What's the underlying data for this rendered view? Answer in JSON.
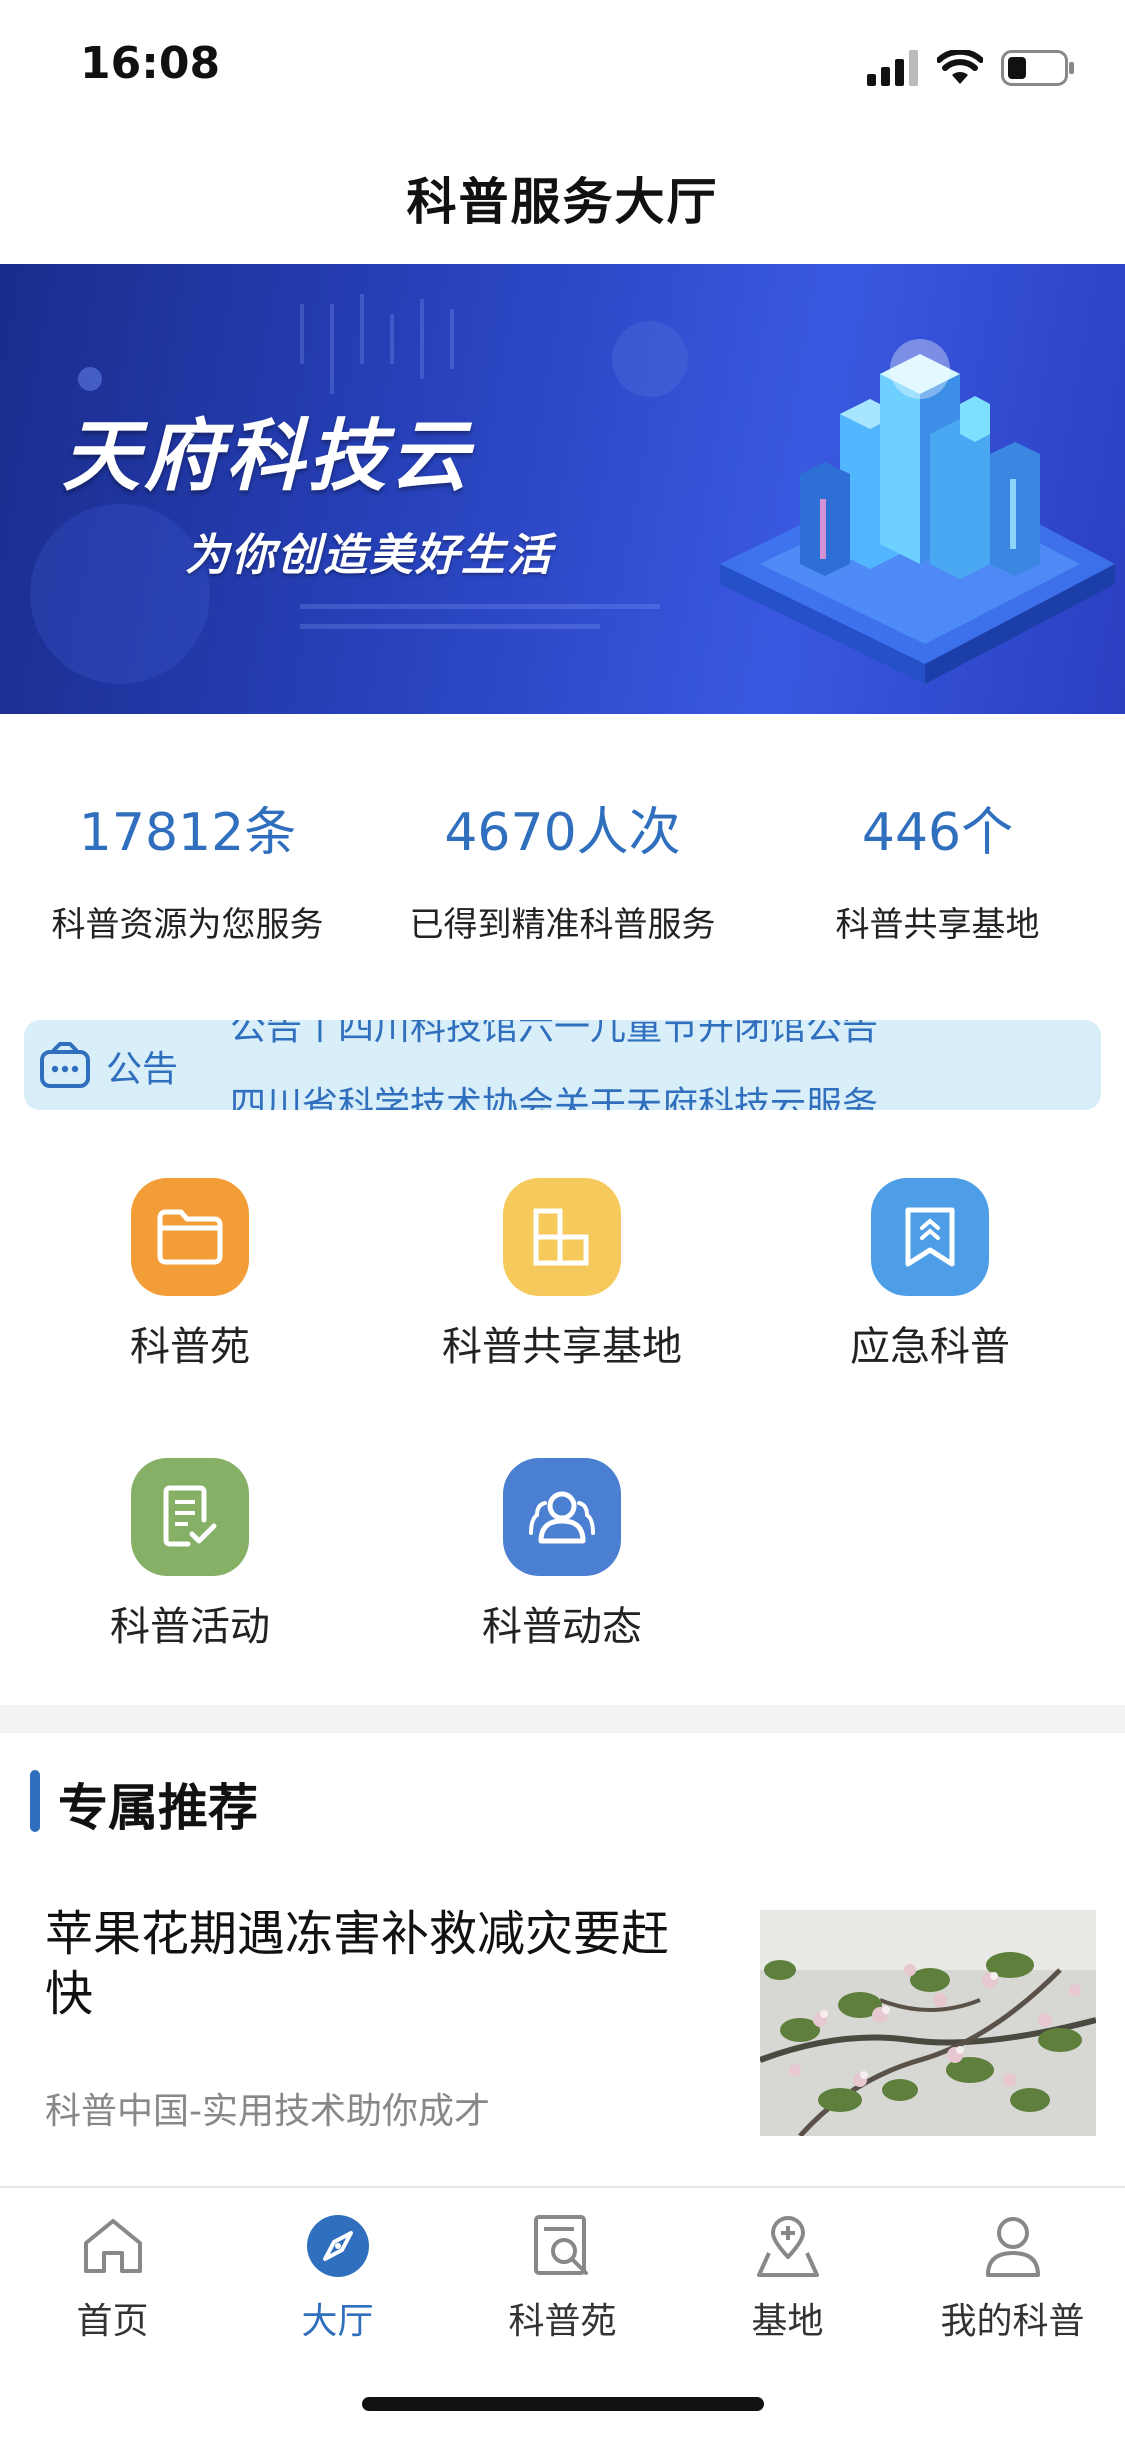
{
  "status_bar": {
    "time": "16:08"
  },
  "nav": {
    "title": "科普服务大厅"
  },
  "banner": {
    "title": "天府科技云",
    "subtitle": "为你创造美好生活"
  },
  "stats": [
    {
      "value": "17812条",
      "label": "科普资源为您服务"
    },
    {
      "value": "4670人次",
      "label": "已得到精准科普服务"
    },
    {
      "value": "446个",
      "label": "科普共享基地"
    }
  ],
  "notice": {
    "label": "公告",
    "lines": [
      "公告丨四川科技馆六一儿童节开闭馆公告",
      "四川省科学技术协会关于天府科技云服务"
    ]
  },
  "grid": [
    {
      "label": "科普苑",
      "icon": "folder-icon",
      "color": "#f29d38"
    },
    {
      "label": "科普共享基地",
      "icon": "grid-blocks-icon",
      "color": "#f6c95d"
    },
    {
      "label": "应急科普",
      "icon": "bookmark-icon",
      "color": "#4d9ee6"
    },
    {
      "label": "科普活动",
      "icon": "checklist-icon",
      "color": "#86b066"
    },
    {
      "label": "科普动态",
      "icon": "people-icon",
      "color": "#4b7fd1"
    }
  ],
  "recommend": {
    "title": "专属推荐",
    "article": {
      "title": "苹果花期遇冻害补救减灾要赶快",
      "source": "科普中国-实用技术助你成才",
      "thumb": "apple-blossom-photo"
    }
  },
  "tabs": [
    {
      "label": "首页",
      "icon": "home-icon",
      "active": false
    },
    {
      "label": "大厅",
      "icon": "compass-icon",
      "active": true
    },
    {
      "label": "科普苑",
      "icon": "document-search-icon",
      "active": false
    },
    {
      "label": "基地",
      "icon": "map-pin-icon",
      "active": false
    },
    {
      "label": "我的科普",
      "icon": "user-icon",
      "active": false
    }
  ],
  "colors": {
    "accent": "#2f6fbd",
    "notice_bg": "#d8eef9",
    "divider": "#f3f3f3"
  }
}
